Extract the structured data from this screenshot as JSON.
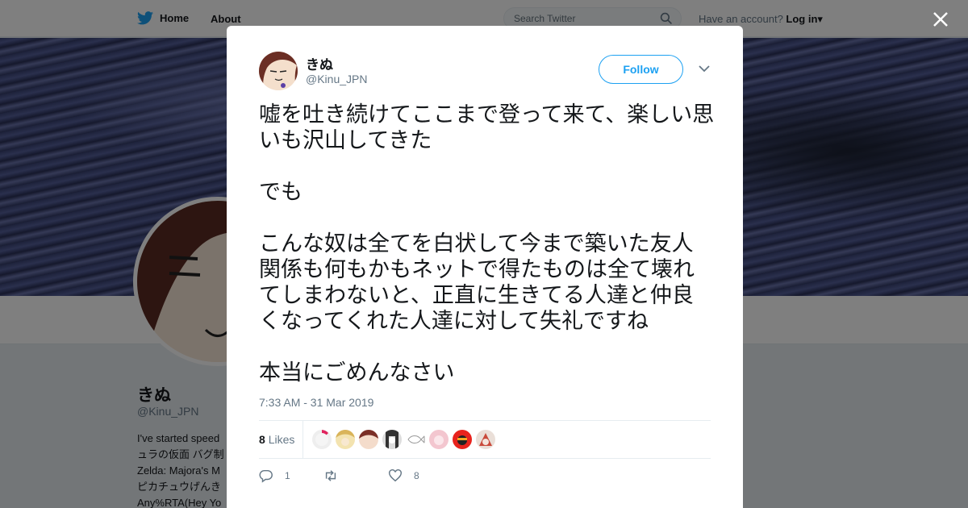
{
  "nav": {
    "home_label": "Home",
    "about_label": "About",
    "search_placeholder": "Search Twitter",
    "have_account_text": "Have an account?",
    "login_label": "Log in"
  },
  "profile": {
    "name": "きぬ",
    "handle": "@Kinu_JPN",
    "bio_lines": [
      "I've started speed",
      "ュラの仮面 バグ制",
      "Zelda: Majora's M",
      "ピカチュウげんき",
      "Any%RTA(Hey Yo"
    ]
  },
  "tweet": {
    "author_name": "きぬ",
    "author_handle": "@Kinu_JPN",
    "follow_label": "Follow",
    "text": "嘘を吐き続けてここまで登って来て、楽しい思いも沢山してきた\n\nでも\n\nこんな奴は全てを白状して今まで築いた友人関係も何もかもネットで得たものは全て壊れてしまわないと、正直に生きてる人達と仲良くなってくれた人達に対して失礼ですね\n\n本当にごめんなさい",
    "timestamp": "7:33 AM - 31 Mar 2019",
    "likes_count": "8",
    "likes_label": "Likes",
    "reply_count": "1",
    "retweet_count": "",
    "like_count": "8"
  },
  "icons": {
    "brand": "twitter-bird-icon",
    "search": "search-icon",
    "close": "close-icon",
    "more": "chevron-down-icon",
    "reply": "reply-icon",
    "retweet": "retweet-icon",
    "like": "heart-icon"
  },
  "colors": {
    "accent": "#1da1f2",
    "text": "#14171a",
    "muted": "#657786"
  }
}
